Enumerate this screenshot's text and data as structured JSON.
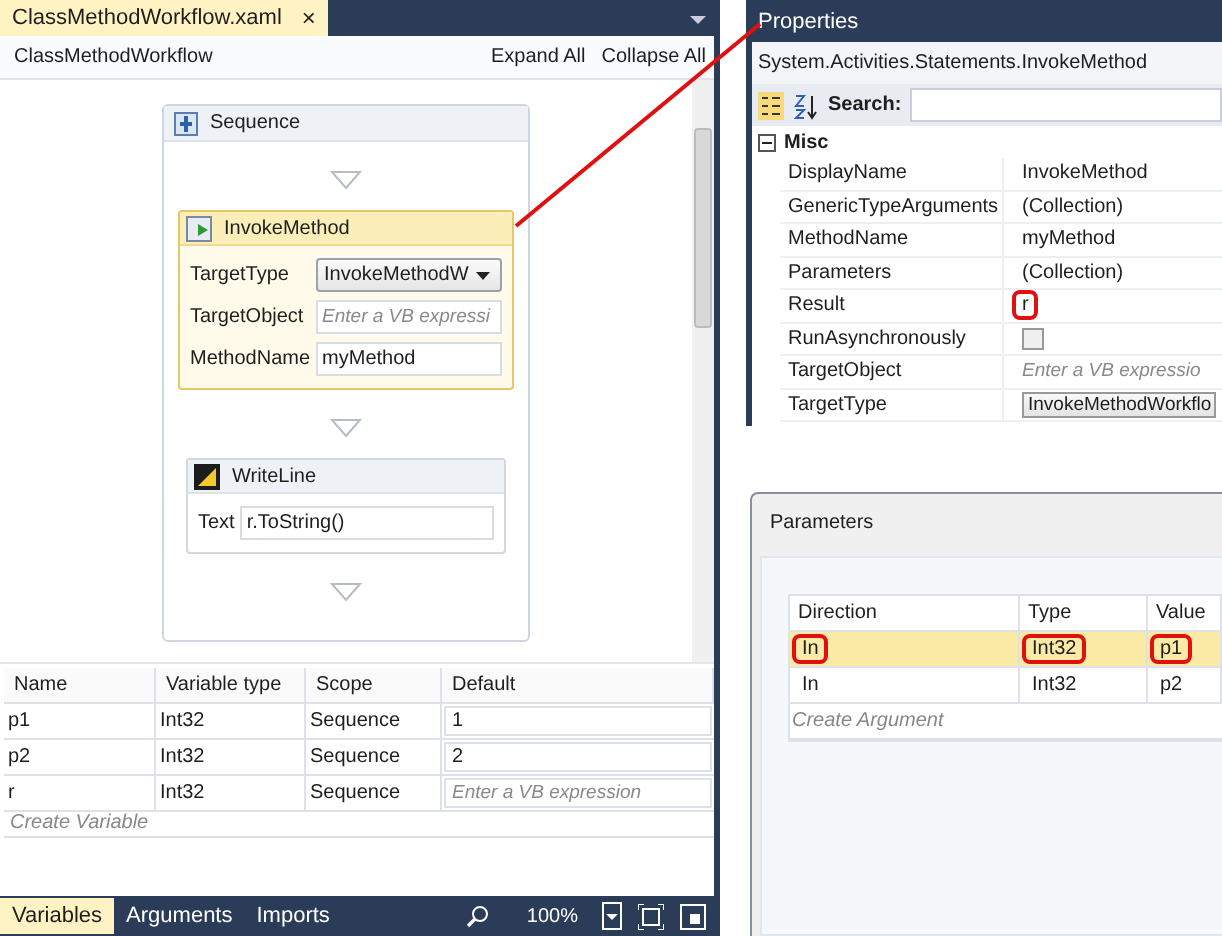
{
  "designer": {
    "tab": {
      "title": "ClassMethodWorkflow.xaml",
      "close": "×"
    },
    "breadcrumb": "ClassMethodWorkflow",
    "expand_all": "Expand All",
    "collapse_all": "Collapse All",
    "sequence": {
      "title": "Sequence",
      "activities": [
        {
          "kind": "invoke",
          "title": "InvokeMethod",
          "selected": true,
          "fields": [
            {
              "label": "TargetType",
              "kind": "dropdown",
              "value": "InvokeMethodW"
            },
            {
              "label": "TargetObject",
              "kind": "text",
              "placeholder": "Enter a VB expressi"
            },
            {
              "label": "MethodName",
              "kind": "text",
              "value": "myMethod"
            }
          ]
        },
        {
          "kind": "writeline",
          "title": "WriteLine",
          "selected": false,
          "fields": [
            {
              "label": "Text",
              "kind": "text",
              "value": "r.ToString()"
            }
          ]
        }
      ]
    },
    "variables": {
      "columns": [
        "Name",
        "Variable type",
        "Scope",
        "Default"
      ],
      "rows": [
        {
          "name": "p1",
          "type": "Int32",
          "scope": "Sequence",
          "default": "1"
        },
        {
          "name": "p2",
          "type": "Int32",
          "scope": "Sequence",
          "default": "2"
        },
        {
          "name": "r",
          "type": "Int32",
          "scope": "Sequence",
          "placeholder": "Enter a VB expression"
        }
      ],
      "create": "Create Variable"
    },
    "bottom_tabs": [
      {
        "label": "Variables",
        "selected": true
      },
      {
        "label": "Arguments",
        "selected": false
      },
      {
        "label": "Imports",
        "selected": false
      }
    ],
    "zoom": "100%"
  },
  "properties": {
    "title": "Properties",
    "type_name": "System.Activities.Statements.InvokeMethod",
    "search_label": "Search:",
    "category": {
      "label": "Misc",
      "expanded": true
    },
    "rows": [
      {
        "name": "DisplayName",
        "kind": "text",
        "value": "InvokeMethod",
        "highlighted": false
      },
      {
        "name": "GenericTypeArguments",
        "kind": "collection",
        "value": "(Collection)",
        "highlighted": false
      },
      {
        "name": "MethodName",
        "kind": "text",
        "value": "myMethod",
        "highlighted": false
      },
      {
        "name": "Parameters",
        "kind": "collection",
        "value": "(Collection)",
        "highlighted": false
      },
      {
        "name": "Result",
        "kind": "text",
        "value": "r",
        "highlighted": true
      },
      {
        "name": "RunAsynchronously",
        "kind": "checkbox",
        "checked": false,
        "highlighted": false
      },
      {
        "name": "TargetObject",
        "kind": "text",
        "placeholder": "Enter a VB expressio",
        "highlighted": false
      },
      {
        "name": "TargetType",
        "kind": "dropdown",
        "value": "InvokeMethodWorkflo",
        "highlighted": false
      }
    ]
  },
  "parameters": {
    "title": "Parameters",
    "columns": [
      "Direction",
      "Type",
      "Value"
    ],
    "rows": [
      {
        "direction": "In",
        "type": "Int32",
        "value": "p1",
        "selected": true,
        "highlighted": true
      },
      {
        "direction": "In",
        "type": "Int32",
        "value": "p2",
        "selected": false,
        "highlighted": false
      }
    ],
    "create": "Create Argument"
  }
}
